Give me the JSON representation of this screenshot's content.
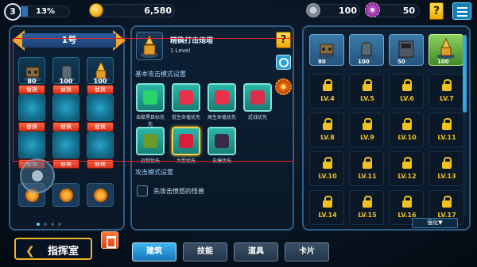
{
  "topbar": {
    "player_level": "3",
    "xp_percent": "13%",
    "xp_fraction": 0.13,
    "coins": "6,580",
    "bolts": "100",
    "gears": "50",
    "quest_button": "?",
    "icons": [
      "coin-icon",
      "bolt-icon",
      "gear-icon",
      "quest-icon",
      "menu-icon"
    ]
  },
  "loadout": {
    "name": "1号",
    "slots": [
      {
        "icon": "cannon-tower-icon",
        "count": "80"
      },
      {
        "icon": "mortar-tower-icon",
        "count": "100"
      },
      {
        "icon": "missile-tower-icon",
        "count": "100"
      }
    ],
    "swap_label": "替换",
    "pages": 4,
    "current_page": 0
  },
  "detail": {
    "tower_name": "精确打击炮塔",
    "tower_level": "1 Level",
    "basic_mode_title": "基本攻击模式设置",
    "modes": [
      {
        "label": "击破黑目标优先",
        "icon": "radar-icon"
      },
      {
        "label": "低生命值优先",
        "icon": "heart-down-icon"
      },
      {
        "label": "高生命值优先",
        "icon": "heart-up-icon"
      },
      {
        "label": "近战优先",
        "icon": "fist-icon"
      },
      {
        "label": "远程优先",
        "icon": "bow-icon"
      },
      {
        "label": "大型优先",
        "icon": "giant-icon",
        "selected": true
      },
      {
        "label": "自爆优先",
        "icon": "bomb-icon"
      }
    ],
    "attack_mode_title": "攻击模式设置",
    "attack_first_angry": "先攻击愤怒的怪兽",
    "help_button": "?"
  },
  "towers": {
    "owned": [
      {
        "icon": "cannon-tower-icon",
        "count": "80"
      },
      {
        "icon": "mortar-tower-icon",
        "count": "100"
      },
      {
        "icon": "wall-tower-icon",
        "count": "50"
      },
      {
        "icon": "missile-tower-icon",
        "count": "100"
      }
    ],
    "locked_levels": [
      "LV.4",
      "LV.5",
      "LV.6",
      "LV.7",
      "LV.8",
      "LV.9",
      "LV.10",
      "LV.11",
      "LV.10",
      "LV.11",
      "LV.12",
      "LV.13",
      "LV.14",
      "LV.15",
      "LV.16",
      "LV.17"
    ],
    "enhance_label": "强化▼"
  },
  "bottom": {
    "back_label": "指挥室",
    "tabs": [
      "建筑",
      "技能",
      "道具",
      "卡片"
    ],
    "active_tab": 0
  }
}
